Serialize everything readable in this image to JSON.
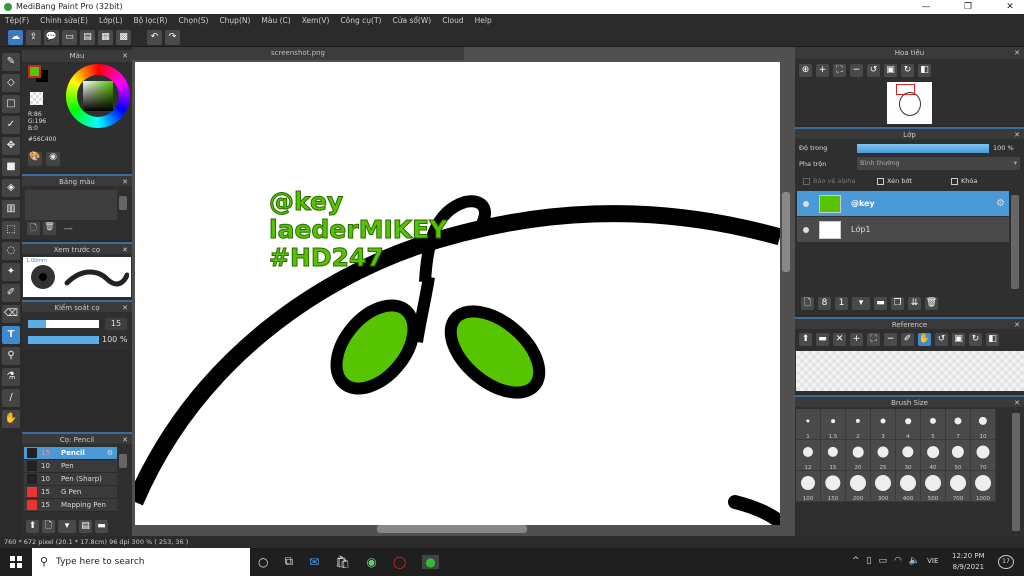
{
  "window": {
    "title": "MediBang Paint Pro (32bit)"
  },
  "menu": [
    "Tệp(F)",
    "Chỉnh sửa(E)",
    "Lớp(L)",
    "Bộ lọc(R)",
    "Chọn(S)",
    "Chụp(N)",
    "Màu (C)",
    "Xem(V)",
    "Công cụ(T)",
    "Cửa sổ(W)",
    "Cloud",
    "Help"
  ],
  "color_panel": {
    "title": "Màu",
    "r": "R:86",
    "g": "G:196",
    "b": "B:0",
    "hex": "#56C400",
    "fg": "#56C400"
  },
  "palette_panel": {
    "title": "Bảng màu",
    "dash": "---"
  },
  "brush_preview": {
    "title": "Xem trước cọ",
    "size": "1.00mm"
  },
  "brush_control": {
    "title": "Kiểm soát cọ",
    "size": "15",
    "opacity": "100 %",
    "size_fraction": 0.25,
    "opacity_fraction": 1.0
  },
  "brush_list": {
    "title": "Cọ: Pencil",
    "items": [
      {
        "size": "15",
        "name": "Pencil",
        "color": "#222222",
        "selected": true
      },
      {
        "size": "10",
        "name": "Pen",
        "color": "#222222"
      },
      {
        "size": "10",
        "name": "Pen (Sharp)",
        "color": "#222222"
      },
      {
        "size": "15",
        "name": "G Pen",
        "color": "#ee3333"
      },
      {
        "size": "15",
        "name": "Mapping Pen",
        "color": "#ee3333"
      }
    ]
  },
  "canvas": {
    "tab": "screenshot.png",
    "text": [
      "@key",
      "laederMIKEY",
      "#HD247"
    ]
  },
  "status": "760 * 672 pixel   (20.1 * 17.8cm)   96 dpi   300 %   ( 253, 36 )",
  "navigator": {
    "title": "Hoa tiêu"
  },
  "layer_panel": {
    "title": "Lớp",
    "opacity_label": "Độ trong",
    "opacity": "100 %",
    "blend_label": "Pha trộn",
    "blend": "Bình thường",
    "alpha_protect": "Bảo vệ alpha",
    "clipping": "Xén bớt",
    "lock": "Khóa",
    "layers": [
      {
        "name": "@key",
        "selected": true
      },
      {
        "name": "Lớp1",
        "selected": false
      }
    ]
  },
  "reference": {
    "title": "Reference"
  },
  "brush_size": {
    "title": "Brush Size",
    "sizes": [
      "1",
      "1.5",
      "2",
      "3",
      "4",
      "5",
      "7",
      "10",
      "12",
      "15",
      "20",
      "25",
      "30",
      "40",
      "50",
      "70",
      "100",
      "150",
      "200",
      "300",
      "400",
      "500",
      "700",
      "1000"
    ]
  },
  "taskbar": {
    "search": "Type here to search",
    "lang": "VIE",
    "time": "12:20 PM",
    "date": "8/9/2021",
    "notif": "17"
  }
}
